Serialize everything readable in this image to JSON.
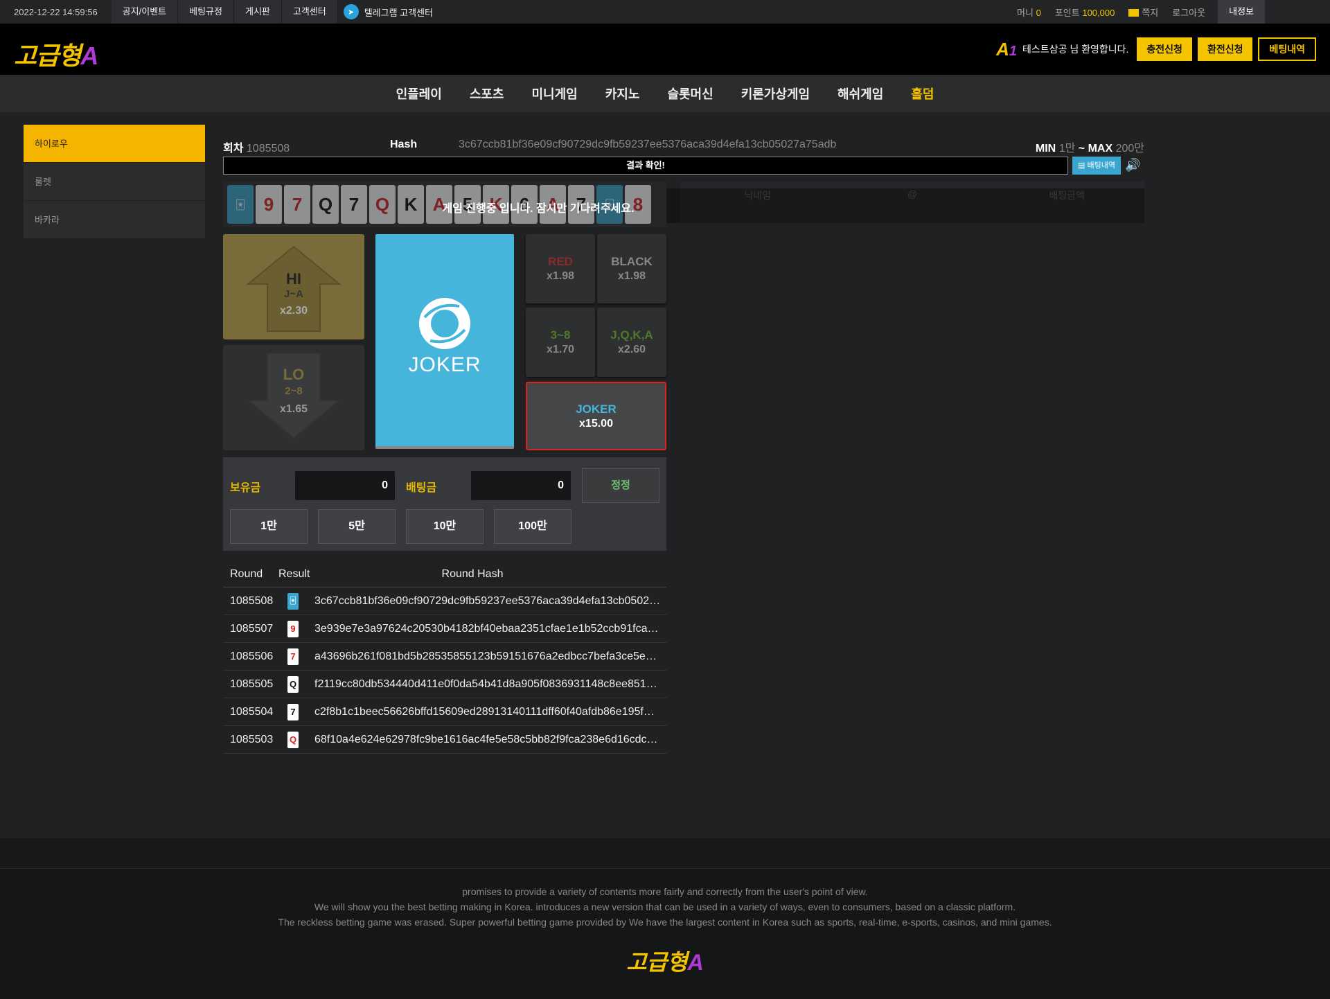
{
  "topbar": {
    "datetime": "2022-12-22 14:59:56",
    "links": [
      "공지/이벤트",
      "베팅규정",
      "게시판",
      "고객센터"
    ],
    "telegram_label": "텔레그램 고객센터",
    "money_label": "머니",
    "money_value": "0",
    "point_label": "포인트",
    "point_value": "100,000",
    "mail_label": "쪽지",
    "logout_label": "로그아웃",
    "myinfo_label": "내정보"
  },
  "header": {
    "logo_text": "고급형",
    "logo_accent": "A",
    "badge_a": "A",
    "badge_1": "1",
    "welcome": "테스트삼공 님 환영합니다.",
    "btn_deposit": "충전신청",
    "btn_withdraw": "환전신청",
    "btn_history": "베팅내역"
  },
  "nav": [
    "인플레이",
    "스포츠",
    "미니게임",
    "카지노",
    "슬롯머신",
    "키론가상게임",
    "해쉬게임",
    "홀덤"
  ],
  "nav_active_index": 7,
  "sidebar": [
    "하이로우",
    "룰렛",
    "바카라"
  ],
  "game": {
    "round_label": "회차",
    "round_value": "1085508",
    "hash_label": "Hash",
    "hash_value": "3c67ccb81bf36e09cf90729dc9fb59237ee5376aca39d4efa13cb05027a75adb",
    "min_label": "MIN",
    "min_value": "1만",
    "tilde": "~",
    "max_label": "MAX",
    "max_value": "200만",
    "result_bar": "결과 확인!",
    "history_btn": "배팅내역",
    "wait_message": "게임 진행중 입니다. 잠시만 기다려주세요.",
    "table_headers": [
      "닉네임",
      "@",
      "배팅금액"
    ],
    "strip_cards": [
      {
        "v": "🃏",
        "t": "joker"
      },
      {
        "v": "9",
        "t": "red"
      },
      {
        "v": "7",
        "t": "red"
      },
      {
        "v": "Q",
        "t": "black"
      },
      {
        "v": "7",
        "t": "black"
      },
      {
        "v": "Q",
        "t": "red"
      },
      {
        "v": "K",
        "t": "black"
      },
      {
        "v": "A",
        "t": "red"
      },
      {
        "v": "5",
        "t": "black"
      },
      {
        "v": "K",
        "t": "red"
      },
      {
        "v": "6",
        "t": "black"
      },
      {
        "v": "A",
        "t": "red"
      },
      {
        "v": "7",
        "t": "black"
      },
      {
        "v": "🃏",
        "t": "joker"
      },
      {
        "v": "8",
        "t": "red"
      }
    ],
    "hi": {
      "title": "HI",
      "range": "J~A",
      "mult": "x2.30"
    },
    "lo": {
      "title": "LO",
      "range": "2~8",
      "mult": "x1.65"
    },
    "joker_card_label": "JOKER",
    "red": {
      "title": "RED",
      "mult": "x1.98"
    },
    "black": {
      "title": "BLACK",
      "mult": "x1.98"
    },
    "mid": {
      "title": "3~8",
      "mult": "x1.70"
    },
    "face": {
      "title": "J,Q,K,A",
      "mult": "x2.60"
    },
    "joker_bet": {
      "title": "JOKER",
      "mult": "x15.00"
    },
    "colors": {
      "hi_bg": "#7a6c3a",
      "joker_blue": "#45b5dc",
      "accent": "#f5c400",
      "red": "#d22222",
      "green": "#5b8a2c"
    }
  },
  "betting": {
    "balance_label": "보유금",
    "balance_value": "0",
    "bet_label": "배팅금",
    "bet_value": "0",
    "reset_label": "정정",
    "chips": [
      "1만",
      "5만",
      "10만",
      "100만"
    ]
  },
  "history": {
    "headers": [
      "Round",
      "Result",
      "Round Hash"
    ],
    "rows": [
      {
        "round": "1085508",
        "card": "🃏",
        "type": "joker",
        "hash": "3c67ccb81bf36e09cf90729dc9fb59237ee5376aca39d4efa13cb0502…"
      },
      {
        "round": "1085507",
        "card": "9",
        "type": "red",
        "hash": "3e939e7e3a97624c20530b4182bf40ebaa2351cfae1e1b52ccb91fca…"
      },
      {
        "round": "1085506",
        "card": "7",
        "type": "red",
        "hash": "a43696b261f081bd5b28535855123b59151676a2edbcc7befa3ce5e…"
      },
      {
        "round": "1085505",
        "card": "Q",
        "type": "black",
        "hash": "f2119cc80db534440d411e0f0da54b41d8a905f0836931148c8ee851…"
      },
      {
        "round": "1085504",
        "card": "7",
        "type": "black",
        "hash": "c2f8b1c1beec56626bffd15609ed28913140111dff60f40afdb86e195f…"
      },
      {
        "round": "1085503",
        "card": "Q",
        "type": "red",
        "hash": "68f10a4e624e62978fc9be1616ac4fe5e58c5bb82f9fca238e6d16cdc…"
      }
    ]
  },
  "footer": {
    "lines": [
      "promises to provide a variety of contents more fairly and correctly from the user's point of view.",
      "We will show you the best betting making in Korea. introduces a new version that can be used in a variety of ways, even to consumers, based on a classic platform.",
      "The reckless betting game was erased. Super powerful betting game provided by  We have the largest content in Korea such as sports, real-time, e-sports, casinos, and mini games."
    ],
    "logo_text": "고급형",
    "logo_accent": "A"
  }
}
